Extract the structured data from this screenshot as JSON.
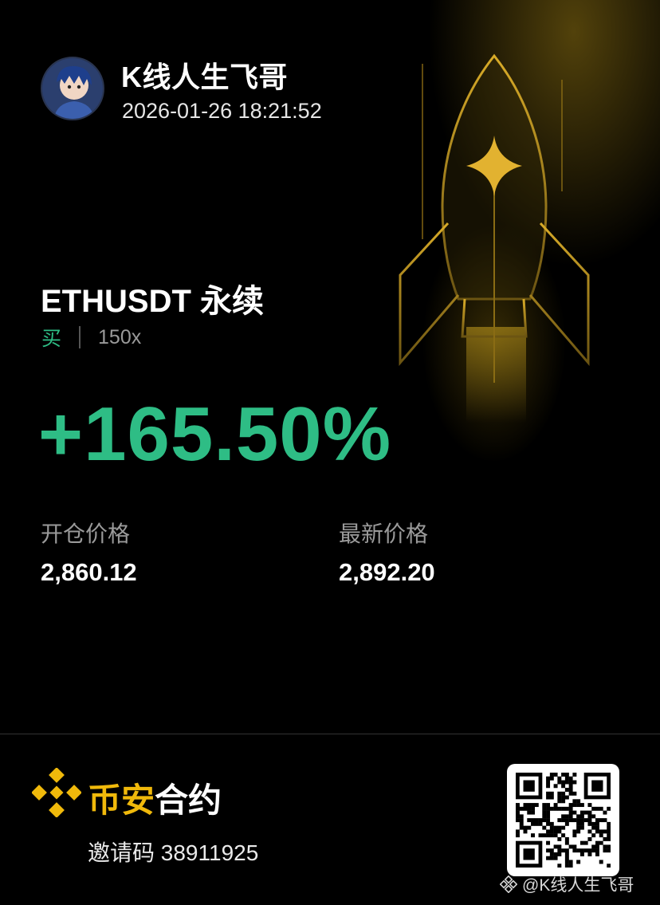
{
  "user": {
    "name": "K线人生飞哥",
    "timestamp": "2026-01-26 18:21:52"
  },
  "position": {
    "symbol": "ETHUSDT 永续",
    "side": "买",
    "leverage": "150x",
    "pnl_percent": "+165.50%"
  },
  "prices": {
    "entry_label": "开仓价格",
    "entry_value": "2,860.12",
    "last_label": "最新价格",
    "last_value": "2,892.20"
  },
  "footer": {
    "brand_highlight": "币安",
    "brand_rest": "合约",
    "invite": "邀请码 38911925"
  },
  "watermark": {
    "text": "@K线人生飞哥"
  },
  "colors": {
    "profit": "#2ebd85",
    "brand": "#f0b90b",
    "background": "#000000"
  },
  "icons": {
    "avatar": "anime-avatar",
    "rocket": "rocket-illustration",
    "logo": "binance-logo-icon",
    "qr": "qr-code",
    "watermark_icon": "binance-mark-icon"
  }
}
